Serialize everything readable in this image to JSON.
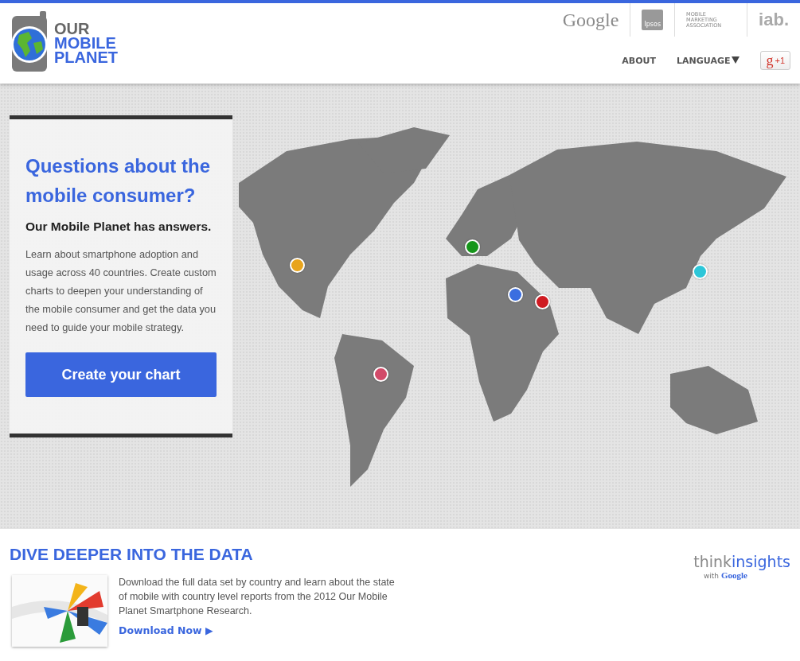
{
  "header": {
    "logo": {
      "line_1": "OUR",
      "line_2": "MOBILE",
      "line_3": "PLANET"
    },
    "partners": [
      {
        "kind": "google",
        "text": "Google"
      },
      {
        "kind": "ipsos",
        "text": "Ipsos"
      },
      {
        "kind": "mma",
        "text": "MOBILE MARKETING ASSOCIATION"
      },
      {
        "kind": "iab",
        "text": "iab."
      }
    ],
    "nav": [
      {
        "label": "ABOUT",
        "caret": false
      },
      {
        "label": "LANGUAGE",
        "caret": true
      }
    ],
    "plus_one": {
      "g": "g",
      "label": "+1"
    }
  },
  "hero": {
    "title": "Questions about the mobile consumer?",
    "subtitle": "Our Mobile Planet has answers.",
    "body": "Learn about smartphone adoption and usage across 40 countries. Create custom charts to deepen your understanding of the mobile consumer and get the data you need to guide your mobile strategy.",
    "button": "Create your chart",
    "pins": [
      {
        "color": "#e8a41c"
      },
      {
        "color": "#16951b"
      },
      {
        "color": "#3b6ee0"
      },
      {
        "color": "#cf1b22"
      },
      {
        "color": "#2cc6d8"
      },
      {
        "color": "#d24a69"
      }
    ]
  },
  "data_section": {
    "title": "DIVE DEEPER INTO THE DATA",
    "text": "Download the full data set by country and learn about the state of mobile with country level reports from the 2012 Our Mobile Planet Smartphone Research.",
    "link": "Download Now ▶",
    "brand": {
      "think": "think",
      "insights": "insights",
      "with": "with",
      "google": "Google"
    }
  }
}
